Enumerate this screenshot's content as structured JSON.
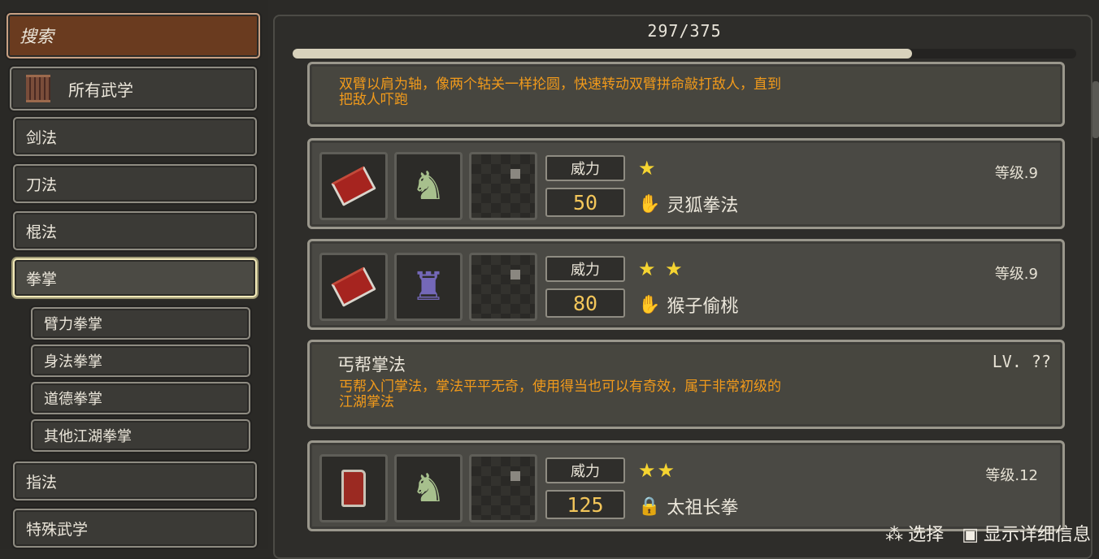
{
  "sidebar": {
    "search_label": "搜索",
    "all_label": "所有武学",
    "categories": [
      "剑法",
      "刀法",
      "棍法",
      "拳掌"
    ],
    "active_category": "拳掌",
    "subcategories": [
      "臂力拳掌",
      "身法拳掌",
      "道德拳掌",
      "其他江湖拳掌"
    ],
    "more_categories": [
      "指法",
      "特殊武学"
    ]
  },
  "header": {
    "counter": "297/375",
    "progress": 0.79
  },
  "cards": {
    "top_desc": {
      "line1": "双臂以肩为轴，像两个轱关一样抡圆，快速转动双臂拼命敲打敌人，直到",
      "line2": "把敌人吓跑"
    },
    "c1": {
      "power_label": "威力",
      "power": "50",
      "stars": "★",
      "name": "灵狐拳法",
      "grade": "等级.9"
    },
    "c2": {
      "power_label": "威力",
      "power": "80",
      "stars": "★ ★",
      "name": "猴子偷桃",
      "grade": "等级.9"
    },
    "info": {
      "title": "丐帮掌法",
      "lv": "LV. ??",
      "line1": "丐帮入门掌法，掌法平平无奇，使用得当也可以有奇效，属于非常初级的",
      "line2": "江湖掌法"
    },
    "c3": {
      "power_label": "威力",
      "power": "125",
      "stars": "★★",
      "name": "太祖长拳",
      "grade": "等级.12"
    }
  },
  "footer": {
    "select_label": "选择",
    "detail_label": "显示详细信息"
  },
  "icons": {
    "scroll": "scroll-icon",
    "hand": "palm-icon",
    "book": "book-icon",
    "figure": "fighter-icon",
    "lock": "lock-icon"
  },
  "colors": {
    "accent_orange": "#f19a1b",
    "star": "#f5d431",
    "power": "#f3c65a",
    "search_bg": "#6a3b1f"
  }
}
